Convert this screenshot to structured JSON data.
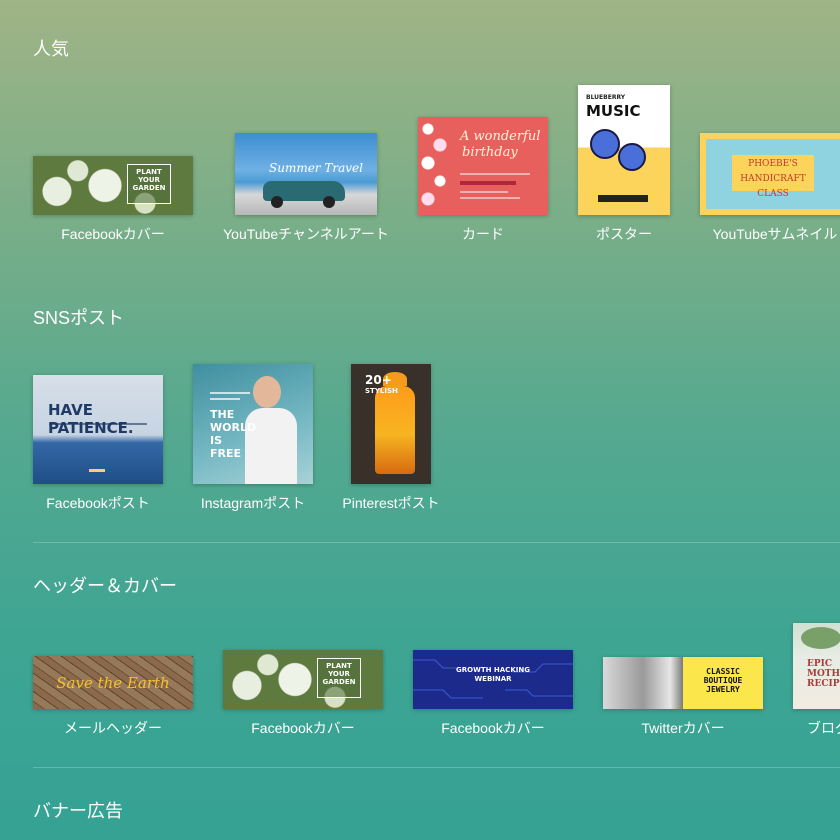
{
  "sections": [
    {
      "title": "人気",
      "items": [
        {
          "label": "Facebookカバー",
          "thumb_text": [
            "PLANT",
            "YOUR",
            "GARDEN"
          ]
        },
        {
          "label": "YouTubeチャンネルアート",
          "thumb_text": [
            "Summer Travel"
          ]
        },
        {
          "label": "カード",
          "thumb_text": [
            "A wonderful",
            "birthday"
          ]
        },
        {
          "label": "ポスター",
          "thumb_text": [
            "BLUEBERRY",
            "MUSIC"
          ]
        },
        {
          "label": "YouTubeサムネイル",
          "thumb_text": [
            "PHOEBE'S",
            "HANDICRAFT CLASS"
          ]
        }
      ]
    },
    {
      "title": "SNSポスト",
      "items": [
        {
          "label": "Facebookポスト",
          "thumb_text": [
            "HAVE PATIENCE."
          ]
        },
        {
          "label": "Instagramポスト",
          "thumb_text": [
            "THE",
            "WORLD",
            "IS",
            "FREE"
          ]
        },
        {
          "label": "Pinterestポスト",
          "thumb_text": [
            "20+",
            "STYLISH"
          ]
        }
      ]
    },
    {
      "title": "ヘッダー＆カバー",
      "items": [
        {
          "label": "メールヘッダー",
          "thumb_text": [
            "Save the Earth"
          ]
        },
        {
          "label": "Facebookカバー",
          "thumb_text": [
            "PLANT",
            "YOUR",
            "GARDEN"
          ]
        },
        {
          "label": "Facebookカバー",
          "thumb_text": [
            "GROWTH HACKING",
            "WEBINAR"
          ]
        },
        {
          "label": "Twitterカバー",
          "thumb_text": [
            "CLASSIC",
            "BOUTIQUE",
            "JEWELRY"
          ]
        },
        {
          "label": "ブログ",
          "thumb_text": [
            "EPIC",
            "MOTHER",
            "RECIPES"
          ]
        }
      ]
    },
    {
      "title": "バナー広告",
      "items": []
    }
  ]
}
